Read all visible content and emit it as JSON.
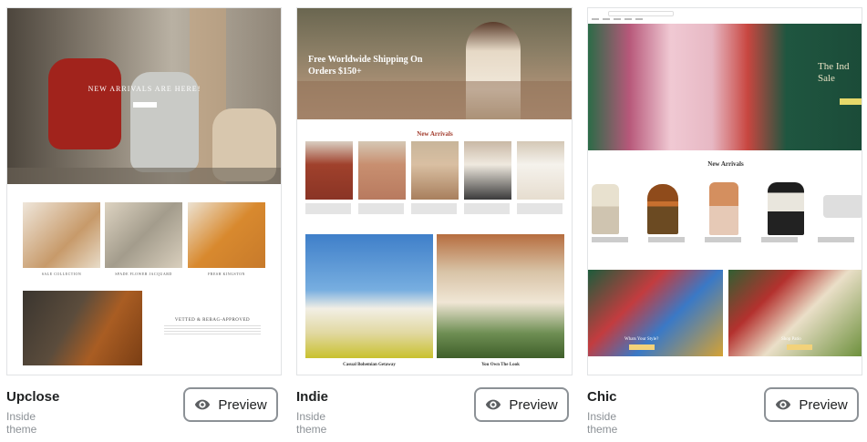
{
  "themes": [
    {
      "name": "Upclose",
      "subtitle": "Inside theme",
      "preview_label": "Preview",
      "thumbnail": {
        "hero_heading": "NEW ARRIVALS ARE HERE!",
        "tiles": [
          "SALE COLLECTION",
          "SPADE FLOWER JACQUARD",
          "FRESH KINGSTON"
        ],
        "feature_heading": "VETTED & REBAG-APPROVED"
      }
    },
    {
      "name": "Indie",
      "subtitle": "Inside theme",
      "preview_label": "Preview",
      "thumbnail": {
        "hero_heading": "Free Worldwide Shipping On Orders $150+",
        "section_heading": "New Arrivals",
        "big_tiles": [
          "Casual Bohemian Getaway",
          "You Own The Look"
        ]
      }
    },
    {
      "name": "Chic",
      "subtitle": "Inside theme",
      "preview_label": "Preview",
      "thumbnail": {
        "hero_heading": "The Ind Sale",
        "section_heading": "New Arrivals",
        "bottom_tiles": [
          "Whats Your Style?",
          "Shop Patio"
        ]
      }
    }
  ],
  "icons": {
    "preview": "eye-icon"
  }
}
